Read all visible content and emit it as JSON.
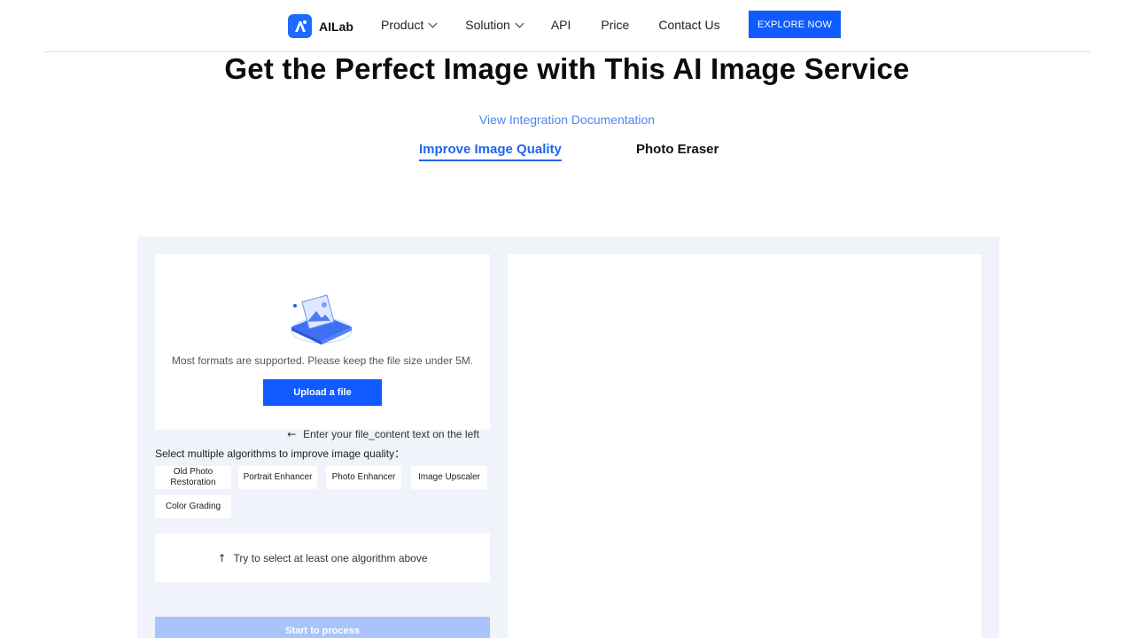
{
  "brand": {
    "name": "AILab",
    "logo_icon": "ailab-logo-icon",
    "accent": "#0f5bff"
  },
  "nav": {
    "items": [
      {
        "label": "Product",
        "has_dropdown": true
      },
      {
        "label": "Solution",
        "has_dropdown": true
      },
      {
        "label": "API",
        "has_dropdown": false
      },
      {
        "label": "Price",
        "has_dropdown": false
      },
      {
        "label": "Contact Us",
        "has_dropdown": false
      }
    ],
    "cta": "EXPLORE NOW"
  },
  "hero": {
    "title": "Get the Perfect Image with This AI Image Service",
    "doc_link": "View Integration Documentation"
  },
  "tabs": [
    {
      "label": "Improve Image Quality",
      "active": true
    },
    {
      "label": "Photo Eraser",
      "active": false
    }
  ],
  "upload": {
    "illustration": "image-upload-illustration",
    "hint": "Most formats are supported. Please keep the file size under 5M.",
    "button": "Upload a file"
  },
  "algorithms": {
    "label": "Select multiple algorithms to improve image quality：",
    "options": [
      "Old Photo Restoration",
      "Portrait Enhancer",
      "Photo Enhancer",
      "Image Upscaler",
      "Color Grading"
    ]
  },
  "selection_hint": {
    "icon": "arrow-up-icon",
    "text": "Try to select at least one algorithm above"
  },
  "process_button": "Start to process",
  "result": {
    "icon": "arrow-left-icon",
    "text": "Enter your file_content text on the left"
  }
}
